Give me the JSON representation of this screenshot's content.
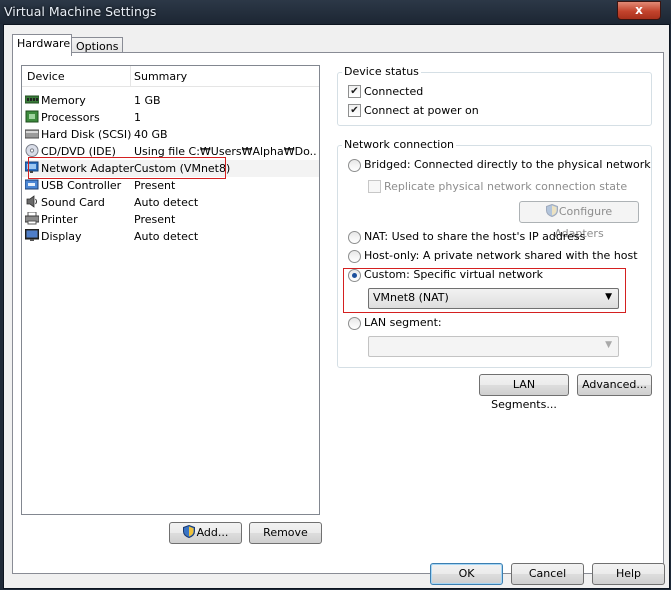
{
  "window": {
    "title": "Virtual Machine Settings",
    "close": "x"
  },
  "tabs": [
    {
      "label": "Hardware"
    },
    {
      "label": "Options"
    }
  ],
  "device_list": {
    "headers": {
      "device": "Device",
      "summary": "Summary"
    },
    "rows": [
      {
        "device": "Memory",
        "summary": "1 GB",
        "icon": "memory-icon"
      },
      {
        "device": "Processors",
        "summary": "1",
        "icon": "processor-icon"
      },
      {
        "device": "Hard Disk (SCSI)",
        "summary": "40 GB",
        "icon": "hard-disk-icon"
      },
      {
        "device": "CD/DVD (IDE)",
        "summary": "Using file C:₩Users₩Alpha₩Do...",
        "icon": "cd-dvd-icon"
      },
      {
        "device": "Network Adapter",
        "summary": "Custom (VMnet8)",
        "icon": "network-adapter-icon"
      },
      {
        "device": "USB Controller",
        "summary": "Present",
        "icon": "usb-icon"
      },
      {
        "device": "Sound Card",
        "summary": "Auto detect",
        "icon": "sound-card-icon"
      },
      {
        "device": "Printer",
        "summary": "Present",
        "icon": "printer-icon"
      },
      {
        "device": "Display",
        "summary": "Auto detect",
        "icon": "display-icon"
      }
    ],
    "selected_row": "Network Adapter"
  },
  "buttons": {
    "add": "Add...",
    "remove": "Remove",
    "ok": "OK",
    "cancel": "Cancel",
    "help": "Help",
    "lan_segments": "LAN Segments...",
    "advanced": "Advanced...",
    "configure_adapters": "Configure Adapters"
  },
  "device_status": {
    "title": "Device status",
    "connected": {
      "label": "Connected",
      "checked": true
    },
    "connect_at_power_on": {
      "label": "Connect at power on",
      "checked": true
    }
  },
  "network_connection": {
    "title": "Network connection",
    "bridged": {
      "label": "Bridged: Connected directly to the physical network",
      "selected": false
    },
    "replicate": {
      "label": "Replicate physical network connection state",
      "checked": false,
      "enabled": false
    },
    "nat": {
      "label": "NAT: Used to share the host's IP address",
      "selected": false
    },
    "host_only": {
      "label": "Host-only: A private network shared with the host",
      "selected": false
    },
    "custom": {
      "label": "Custom: Specific virtual network",
      "selected": true
    },
    "custom_network": "VMnet8 (NAT)",
    "lan_segment": {
      "label": "LAN segment:",
      "selected": false
    },
    "lan_segment_value": ""
  },
  "colors": {
    "highlight_box": "#d42020",
    "title_bar": "#1f2a38",
    "radio_dot": "#1c4f9c"
  }
}
